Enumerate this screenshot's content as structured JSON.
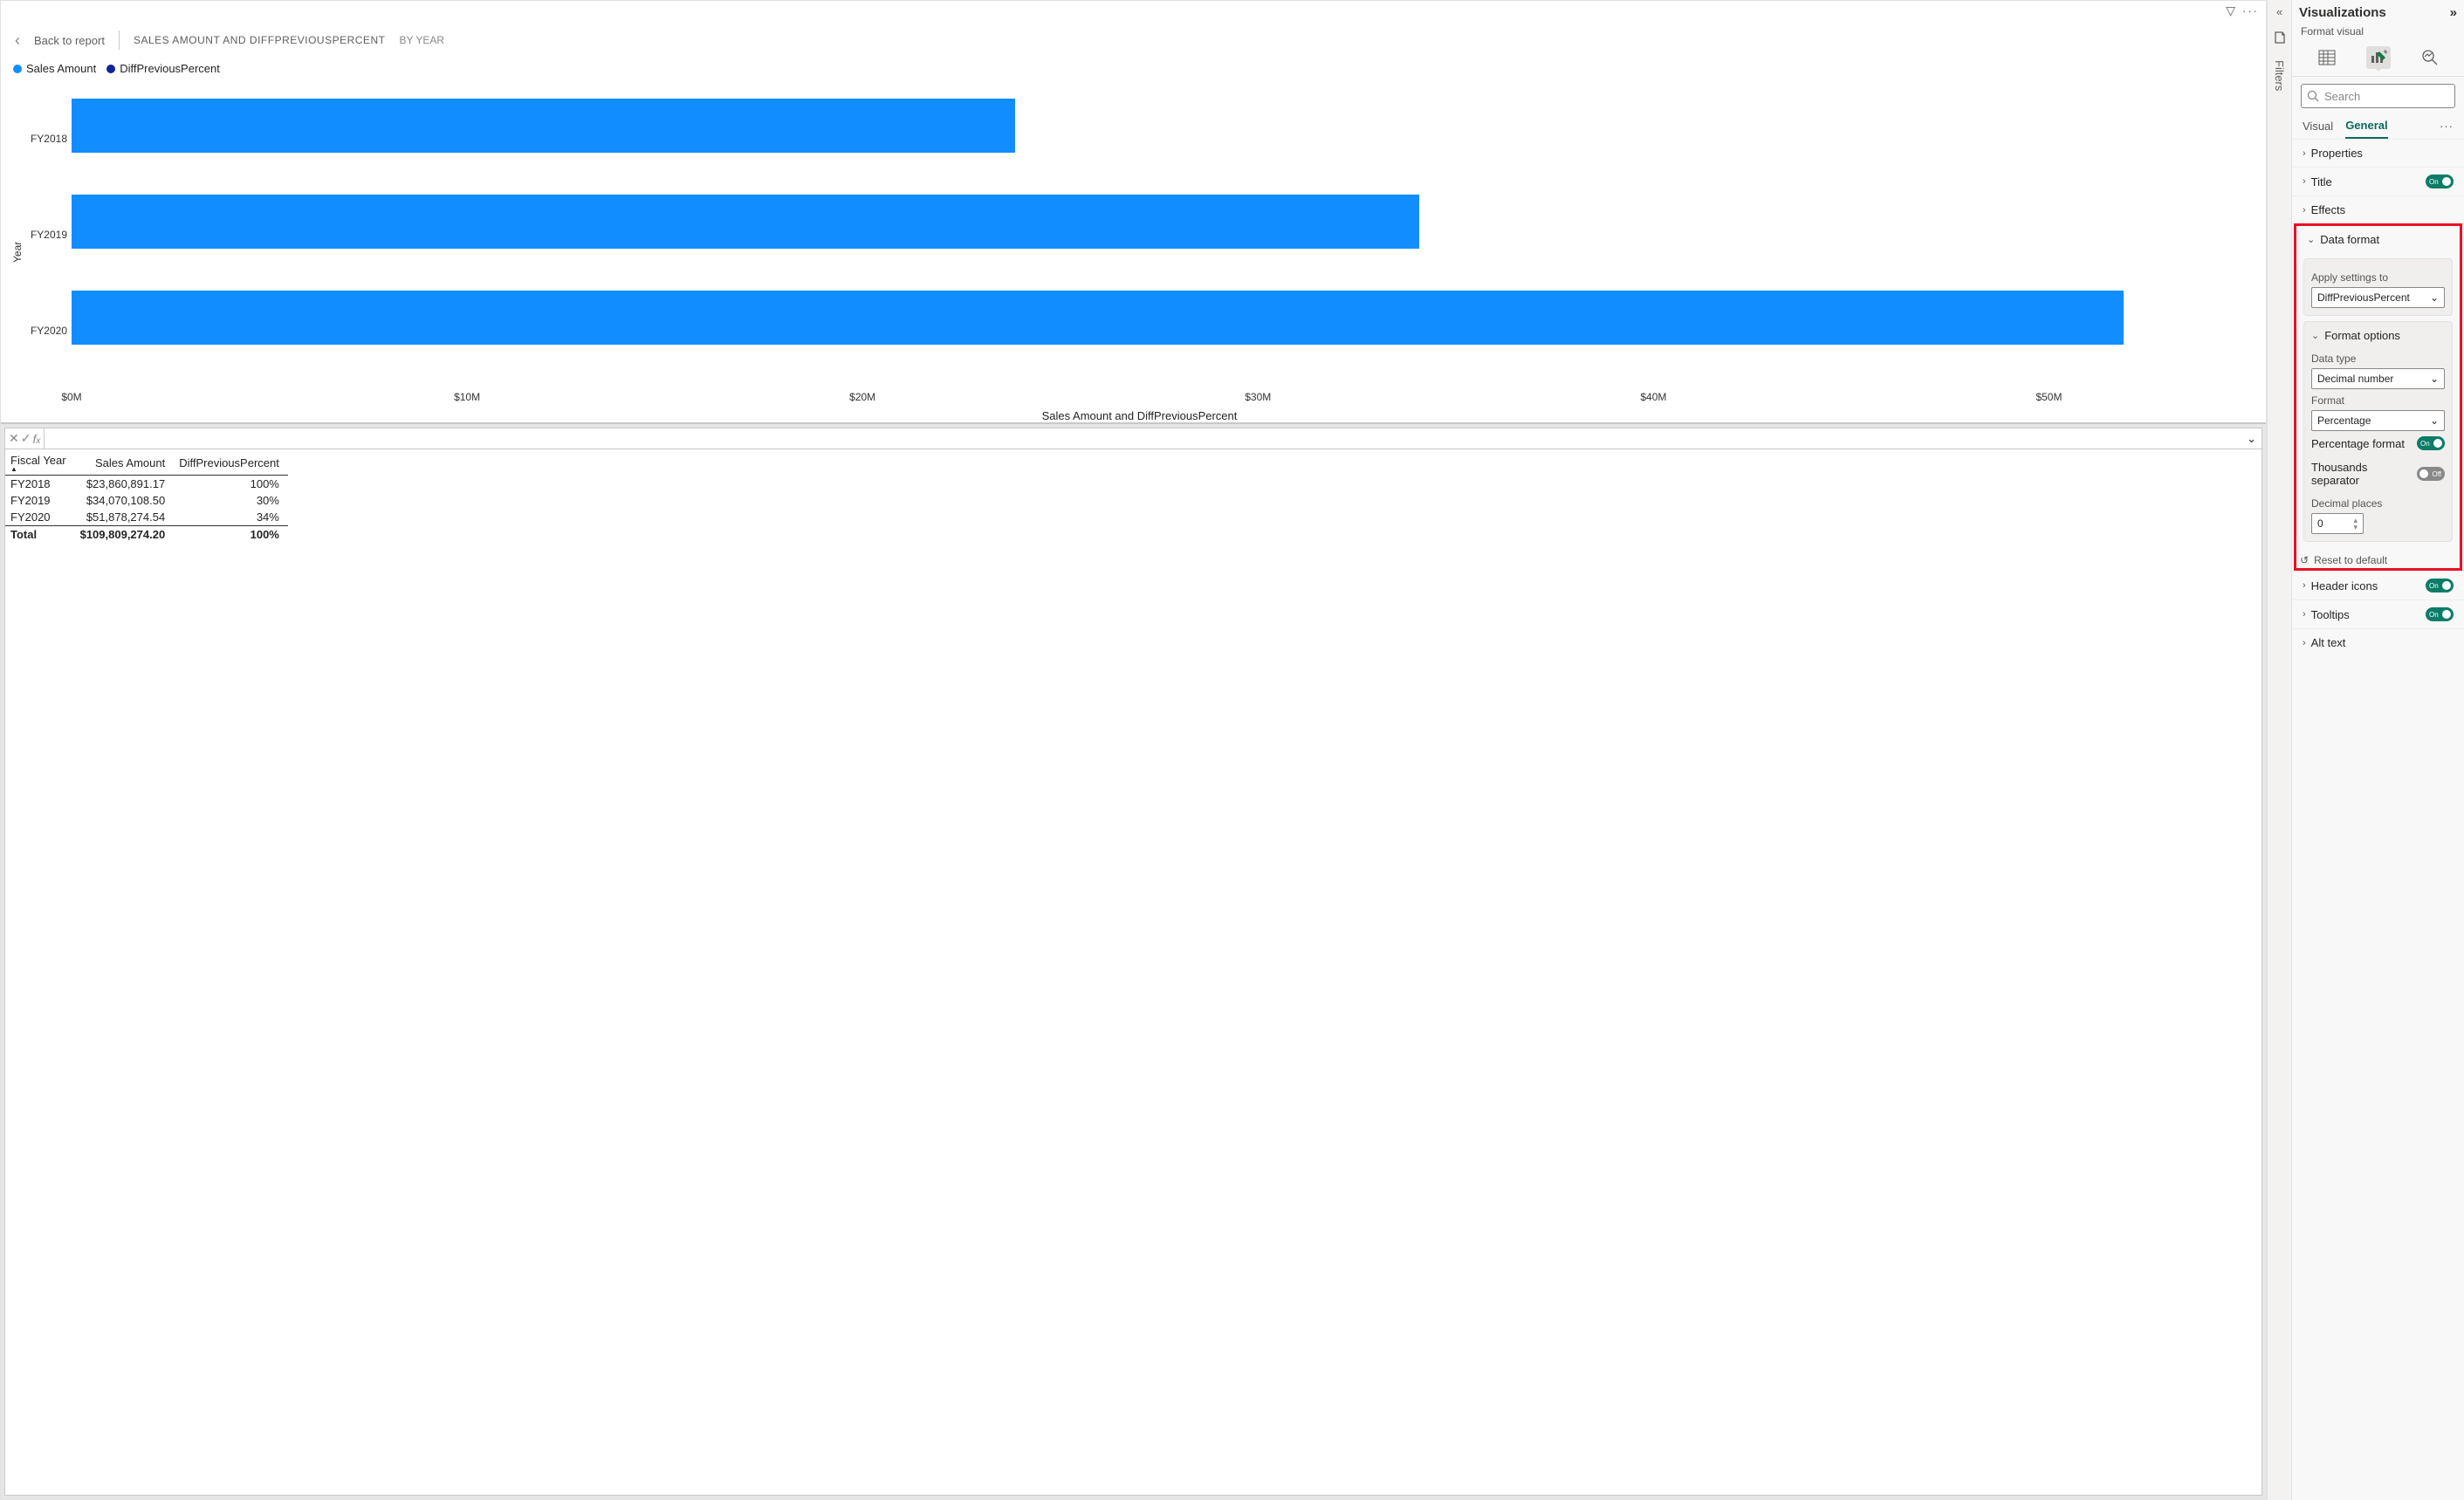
{
  "header": {
    "back_label": "Back to report",
    "title": "SALES AMOUNT AND DIFFPREVIOUSPERCENT",
    "subtitle": "BY YEAR"
  },
  "legend": {
    "series1": "Sales Amount",
    "series2": "DiffPreviousPercent",
    "color1": "#118dff",
    "color2": "#12239e"
  },
  "chart_data": {
    "type": "bar",
    "orientation": "horizontal",
    "categories": [
      "FY2018",
      "FY2019",
      "FY2020"
    ],
    "values": [
      23.86,
      34.07,
      51.88
    ],
    "xlabel": "Sales Amount and DiffPreviousPercent",
    "ylabel": "Year",
    "xlim": [
      0,
      55
    ],
    "x_ticks": [
      "$0M",
      "$10M",
      "$20M",
      "$30M",
      "$40M",
      "$50M"
    ],
    "x_tick_values": [
      0,
      10,
      20,
      30,
      40,
      50
    ]
  },
  "table": {
    "columns": [
      "Fiscal Year",
      "Sales Amount",
      "DiffPreviousPercent"
    ],
    "rows": [
      [
        "FY2018",
        "$23,860,891.17",
        "100%"
      ],
      [
        "FY2019",
        "$34,070,108.50",
        "30%"
      ],
      [
        "FY2020",
        "$51,878,274.54",
        "34%"
      ]
    ],
    "total": [
      "Total",
      "$109,809,274.20",
      "100%"
    ]
  },
  "filters_label": "Filters",
  "viz": {
    "title": "Visualizations",
    "subtitle": "Format visual",
    "search_placeholder": "Search",
    "tab_visual": "Visual",
    "tab_general": "General",
    "sections": {
      "properties": "Properties",
      "title": "Title",
      "effects": "Effects",
      "data_format": "Data format",
      "apply_to_label": "Apply settings to",
      "apply_to_value": "DiffPreviousPercent",
      "format_options": "Format options",
      "data_type_label": "Data type",
      "data_type_value": "Decimal number",
      "format_label": "Format",
      "format_value": "Percentage",
      "pct_format": "Percentage format",
      "thousands": "Thousands separator",
      "decimal_label": "Decimal places",
      "decimal_value": "0",
      "reset": "Reset to default",
      "header_icons": "Header icons",
      "tooltips": "Tooltips",
      "alt_text": "Alt text"
    },
    "toggle_on": "On",
    "toggle_off": "Off"
  }
}
